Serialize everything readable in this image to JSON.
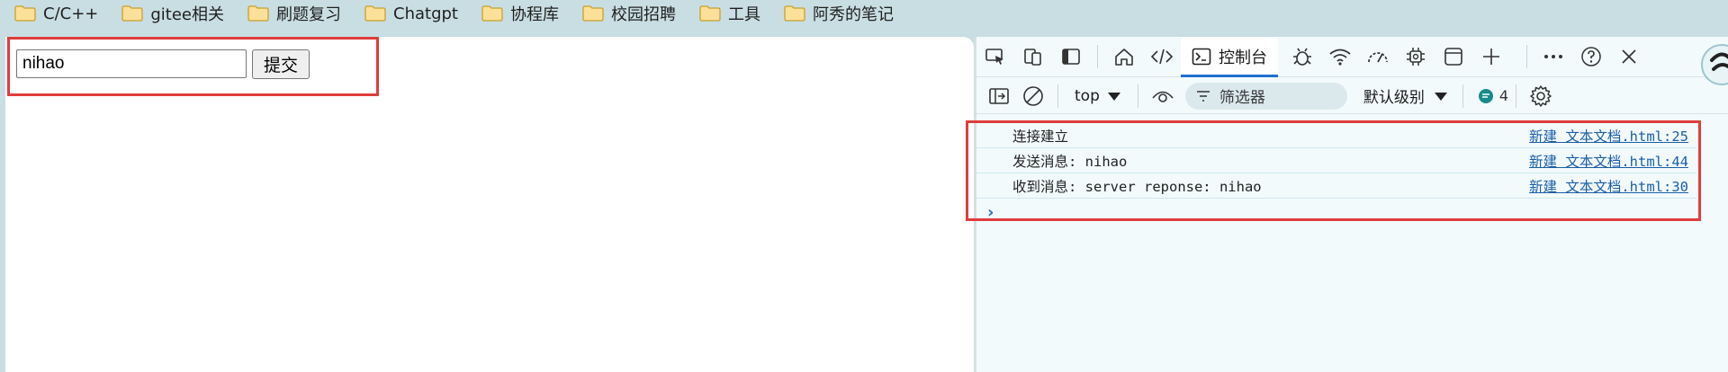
{
  "bookmarks": [
    {
      "label": "C/C++"
    },
    {
      "label": "gitee相关"
    },
    {
      "label": "刷题复习"
    },
    {
      "label": "Chatgpt"
    },
    {
      "label": "协程库"
    },
    {
      "label": "校园招聘"
    },
    {
      "label": "工具"
    },
    {
      "label": "阿秀的笔记"
    }
  ],
  "page": {
    "input_value": "nihao",
    "submit_label": "提交"
  },
  "devtools": {
    "console_tab_label": "控制台",
    "context_label": "top",
    "filter_placeholder": "筛选器",
    "level_label": "默认级别",
    "message_count": "4",
    "messages": [
      {
        "text": "连接建立",
        "source": "新建 文本文档.html:25"
      },
      {
        "text": "发送消息: nihao",
        "source": "新建 文本文档.html:44"
      },
      {
        "text": "收到消息: server reponse: nihao",
        "source": "新建 文本文档.html:30"
      }
    ],
    "prompt": "›"
  },
  "colors": {
    "highlight_border": "#e03c3c",
    "accent": "#1f6fd0",
    "folder": "#f2c94c"
  }
}
